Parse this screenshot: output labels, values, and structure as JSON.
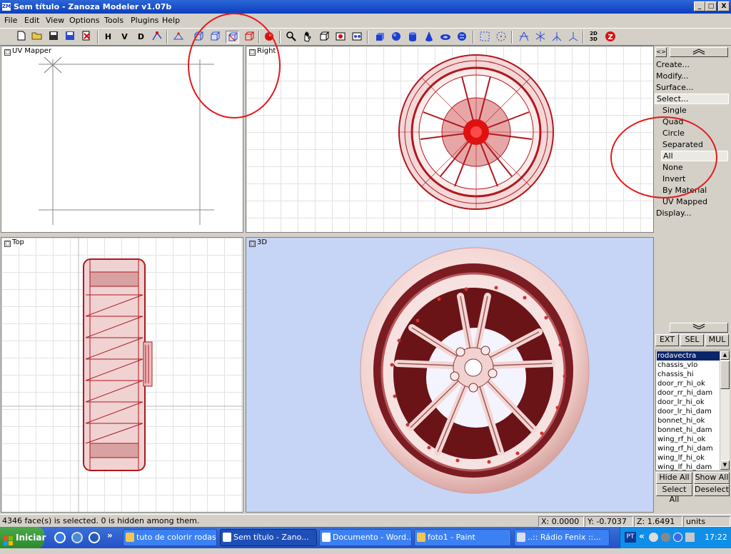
{
  "window": {
    "title": "Sem título - Zanoza Modeler v1.07b",
    "app_icon_label": "ZM",
    "controls": [
      "_",
      "□",
      "X"
    ]
  },
  "menu": {
    "items": [
      "File",
      "Edit",
      "View",
      "Options",
      "Tools",
      "Plugins",
      "Help"
    ]
  },
  "toolbar": {
    "view_letters": [
      "H",
      "V",
      "D"
    ],
    "icons": [
      "new-file-icon",
      "open-folder-icon",
      "save-disk-icon",
      "save-as-icon",
      "close-file-icon",
      "move-vertex-icon",
      "select-vertex-icon",
      "rotate-view-icon",
      "cube-wire-icon",
      "cube-face-icon",
      "cube-selected-icon",
      "cube-red-icon",
      "material-ball-icon",
      "zoom-magnifier-icon",
      "pan-hand-icon",
      "cube-view-icon",
      "camera-icon",
      "camera-all-icon",
      "box-primitive-icon",
      "sphere-primitive-icon",
      "cylinder-primitive-icon",
      "cone-primitive-icon",
      "torus-primitive-icon",
      "ring-primitive-icon",
      "select-rect-icon",
      "select-circle-icon",
      "axis-x-icon",
      "axis-y-icon",
      "axis-z-icon",
      "axis-free-icon",
      "convert-2d-3d-icon",
      "zanoza-logo-icon"
    ],
    "convert_label": "2D\n3D"
  },
  "viewports": {
    "uv": {
      "title": "UV Mapper"
    },
    "right": {
      "title": "Right"
    },
    "top": {
      "title": "Top"
    },
    "three_d": {
      "title": "3D"
    }
  },
  "panel": {
    "menu": [
      "Create...",
      "Modify...",
      "Surface...",
      "Select..."
    ],
    "select_options": [
      "Single",
      "Quad",
      "Circle",
      "Separated",
      "All",
      "None",
      "Invert",
      "By Material",
      "UV Mapped"
    ],
    "active_option": "All",
    "display": "Display...",
    "tabs": [
      "EXT",
      "SEL",
      "MUL"
    ],
    "objects": [
      "rodavectra",
      "chassis_vlo",
      "chassis_hi",
      "door_rr_hi_ok",
      "door_rr_hi_dam",
      "door_lr_hi_ok",
      "door_lr_hi_dam",
      "bonnet_hi_ok",
      "bonnet_hi_dam",
      "wing_rf_hi_ok",
      "wing_rf_hi_dam",
      "wing_lf_hi_ok",
      "wing_lf_hi_dam"
    ],
    "selected_object": "rodavectra",
    "buttons": [
      "Hide All",
      "Show All",
      "Select All",
      "Deselect"
    ]
  },
  "status": {
    "message": "4346 face(s) is selected. 0 is hidden among them.",
    "x": "X: 0.0000",
    "y": "Y: -0.7037",
    "z": "Z: 1.6491",
    "units": "units"
  },
  "taskbar": {
    "start": "Iniciar",
    "quicklaunch_more": "»",
    "tasks": [
      "tuto de colorir rodas",
      "Sem título - Zano...",
      "Documento - Word...",
      "foto1 - Paint",
      "..:: Rádio Fenix ::..."
    ],
    "active_task": "Sem título - Zano...",
    "language": "PT",
    "tray_more": "«",
    "clock": "17:22"
  },
  "colors": {
    "titlebar": "#0a3fbd",
    "wire_red": "#b0181e",
    "render_bg": "#c6d4f5",
    "annotation_circle": "#e31a1a",
    "selection": "#0a246a"
  }
}
